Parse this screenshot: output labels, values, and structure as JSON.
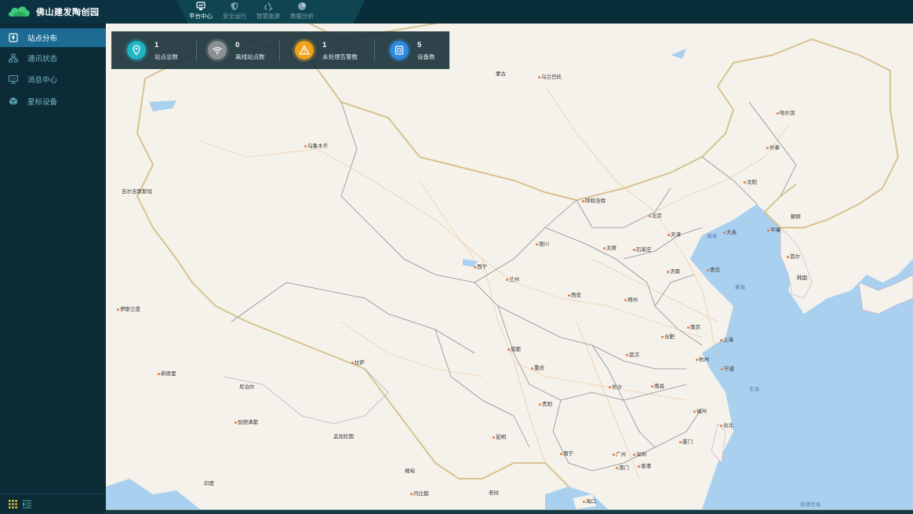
{
  "app": {
    "title": "佛山建发陶创园"
  },
  "nav": [
    {
      "label": "平台中心",
      "icon": "platform-icon",
      "active": true
    },
    {
      "label": "安全运行",
      "icon": "shield-icon",
      "active": false
    },
    {
      "label": "智慧能源",
      "icon": "recycle-icon",
      "active": false
    },
    {
      "label": "数据分析",
      "icon": "pie-chart-icon",
      "active": false
    }
  ],
  "sidebar": {
    "items": [
      {
        "label": "站点分布",
        "icon": "map-pin-icon",
        "active": true
      },
      {
        "label": "通讯状态",
        "icon": "network-icon",
        "active": false
      },
      {
        "label": "消息中心",
        "icon": "monitor-icon",
        "active": false
      },
      {
        "label": "星标设备",
        "icon": "cube-icon",
        "active": false
      }
    ],
    "bottom": {
      "grid_icon": "grid-icon",
      "menu_icon": "menu-collapse-icon"
    }
  },
  "stats": [
    {
      "value": "1",
      "label": "站点总数",
      "icon": "location-icon",
      "color": "#1fb5c4"
    },
    {
      "value": "0",
      "label": "离线站点数",
      "icon": "wifi-icon",
      "color": "#8a8f92"
    },
    {
      "value": "1",
      "label": "未处理告警数",
      "icon": "warning-icon",
      "color": "#f0a21a"
    },
    {
      "value": "5",
      "label": "设备数",
      "icon": "device-icon",
      "color": "#2f8ae0"
    }
  ],
  "map": {
    "cities": [
      {
        "name": "乌鲁木齐",
        "dot": true
      },
      {
        "name": "蒙古",
        "dot": false
      },
      {
        "name": "乌兰巴托",
        "dot": true
      },
      {
        "name": "哈尔滨",
        "dot": true
      },
      {
        "name": "长春",
        "dot": true
      },
      {
        "name": "沈阳",
        "dot": true
      },
      {
        "name": "呼和浩特",
        "dot": true
      },
      {
        "name": "北京",
        "dot": true
      },
      {
        "name": "天津",
        "dot": true
      },
      {
        "name": "石家庄",
        "dot": true
      },
      {
        "name": "太原",
        "dot": true
      },
      {
        "name": "银川",
        "dot": true
      },
      {
        "name": "西宁",
        "dot": true
      },
      {
        "name": "兰州",
        "dot": true
      },
      {
        "name": "济南",
        "dot": true
      },
      {
        "name": "青岛",
        "dot": true
      },
      {
        "name": "郑州",
        "dot": true
      },
      {
        "name": "西安",
        "dot": true
      },
      {
        "name": "南京",
        "dot": true
      },
      {
        "name": "合肥",
        "dot": true
      },
      {
        "name": "上海",
        "dot": true
      },
      {
        "name": "杭州",
        "dot": true
      },
      {
        "name": "宁波",
        "dot": true
      },
      {
        "name": "武汉",
        "dot": true
      },
      {
        "name": "成都",
        "dot": true
      },
      {
        "name": "重庆",
        "dot": true
      },
      {
        "name": "拉萨",
        "dot": true
      },
      {
        "name": "长沙",
        "dot": true
      },
      {
        "name": "南昌",
        "dot": true
      },
      {
        "name": "福州",
        "dot": true
      },
      {
        "name": "贵阳",
        "dot": true
      },
      {
        "name": "昆明",
        "dot": true
      },
      {
        "name": "南宁",
        "dot": true
      },
      {
        "name": "广州",
        "dot": true
      },
      {
        "name": "深圳",
        "dot": true
      },
      {
        "name": "香港",
        "dot": true
      },
      {
        "name": "澳门",
        "dot": true
      },
      {
        "name": "台北",
        "dot": true
      },
      {
        "name": "海口",
        "dot": true
      },
      {
        "name": "朝鲜",
        "dot": false
      },
      {
        "name": "韩国",
        "dot": false
      },
      {
        "name": "首尔",
        "dot": true
      },
      {
        "name": "平壤",
        "dot": true
      },
      {
        "name": "大连",
        "dot": true
      },
      {
        "name": "尼泊尔",
        "dot": false
      },
      {
        "name": "孟加拉国",
        "dot": false
      },
      {
        "name": "缅甸",
        "dot": false
      },
      {
        "name": "老挝",
        "dot": false
      },
      {
        "name": "印度",
        "dot": false
      },
      {
        "name": "吉尔吉斯斯坦",
        "dot": false
      },
      {
        "name": "伊斯兰堡",
        "dot": true
      },
      {
        "name": "新德里",
        "dot": true
      },
      {
        "name": "加德满都",
        "dot": true
      },
      {
        "name": "内比都",
        "dot": true
      },
      {
        "name": "厦门",
        "dot": true
      }
    ],
    "seas": [
      {
        "name": "渤海"
      },
      {
        "name": "黄海"
      },
      {
        "name": "东海"
      },
      {
        "name": "菲律宾海"
      }
    ]
  }
}
